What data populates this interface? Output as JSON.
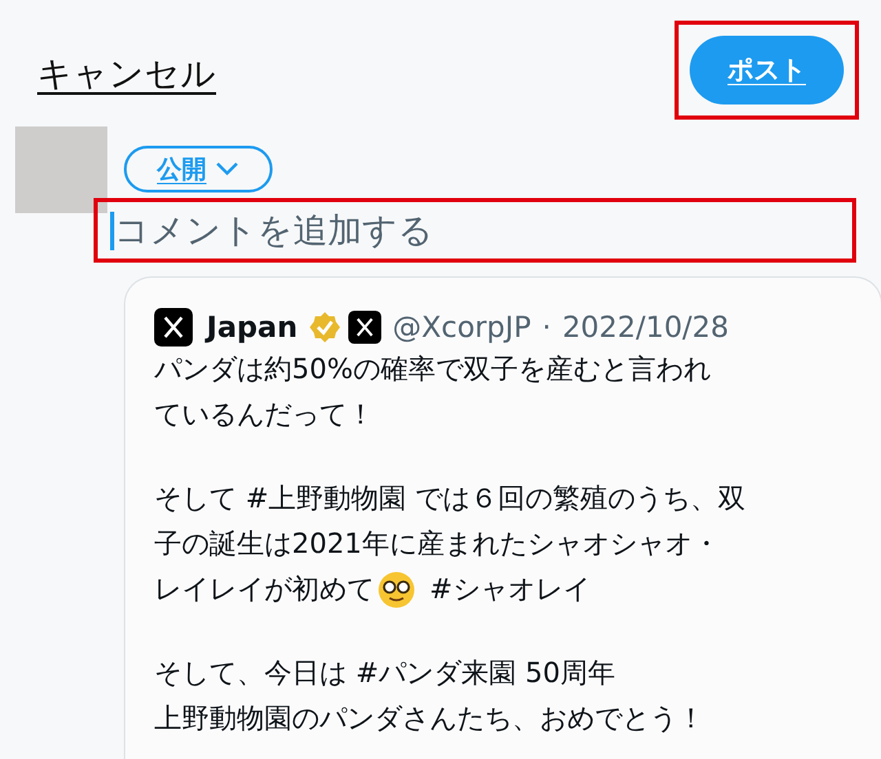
{
  "header": {
    "cancel": "キャンセル",
    "post_button": {
      "label": "ポスト",
      "highlighted": true
    }
  },
  "composer": {
    "audience": "公開",
    "comment_field": {
      "placeholder": "コメントを追加する",
      "highlighted": true
    }
  },
  "quoted_post": {
    "name": "Japan",
    "verified": true,
    "handle": "@XcorpJP",
    "separator": "·",
    "date": "2022/10/28",
    "paragraphs": [
      {
        "lines": [
          {
            "segments": [
              {
                "kind": "text",
                "text": "パンダは約50%の確率で双子を産むと言われ"
              }
            ]
          },
          {
            "segments": [
              {
                "kind": "text",
                "text": "ているんだって！"
              }
            ]
          }
        ]
      },
      {
        "lines": [
          {
            "segments": [
              {
                "kind": "text",
                "text": "そして #上野動物園 では６回の繁殖のうち、双"
              }
            ]
          },
          {
            "segments": [
              {
                "kind": "text",
                "text": "子の誕生は2021年に産まれたシャオシャオ・"
              }
            ]
          },
          {
            "segments": [
              {
                "kind": "text",
                "text": "レイレイが初めて"
              },
              {
                "kind": "emoji"
              },
              {
                "kind": "text",
                "text": "#シャオレイ"
              }
            ]
          }
        ]
      },
      {
        "lines": [
          {
            "segments": [
              {
                "kind": "text",
                "text": "そして、今日は #パンダ来園 50周年"
              }
            ]
          },
          {
            "segments": [
              {
                "kind": "text",
                "text": "上野動物園のパンダさんたち、おめでとう！"
              }
            ]
          }
        ]
      }
    ]
  }
}
